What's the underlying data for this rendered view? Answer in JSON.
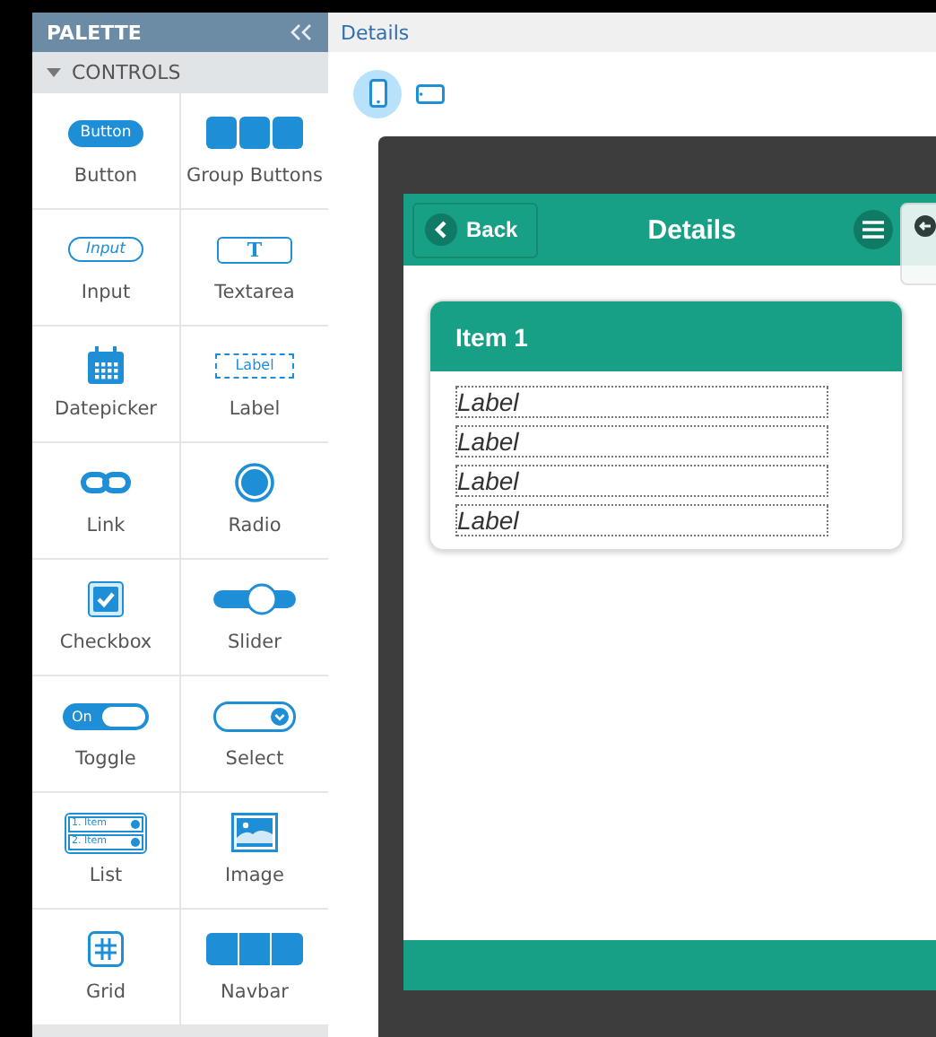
{
  "palette": {
    "title": "PALETTE",
    "section": {
      "label": "CONTROLS",
      "expanded": true
    },
    "items": [
      {
        "kind": "button",
        "label": "Button",
        "icon_text": "Button"
      },
      {
        "kind": "group-buttons",
        "label": "Group Buttons"
      },
      {
        "kind": "input",
        "label": "Input",
        "icon_text": "Input"
      },
      {
        "kind": "textarea",
        "label": "Textarea",
        "icon_text": "T"
      },
      {
        "kind": "datepicker",
        "label": "Datepicker"
      },
      {
        "kind": "label",
        "label": "Label",
        "icon_text": "Label"
      },
      {
        "kind": "link",
        "label": "Link"
      },
      {
        "kind": "radio",
        "label": "Radio"
      },
      {
        "kind": "checkbox",
        "label": "Checkbox"
      },
      {
        "kind": "slider",
        "label": "Slider"
      },
      {
        "kind": "toggle",
        "label": "Toggle",
        "icon_text": "On"
      },
      {
        "kind": "select",
        "label": "Select"
      },
      {
        "kind": "list",
        "label": "List",
        "icon_rows": [
          "1. Item",
          "2. Item"
        ]
      },
      {
        "kind": "image",
        "label": "Image"
      },
      {
        "kind": "grid",
        "label": "Grid"
      },
      {
        "kind": "navbar",
        "label": "Navbar"
      }
    ]
  },
  "editor": {
    "tabs": [
      {
        "label": "Details",
        "selected": true
      }
    ],
    "devices": [
      {
        "kind": "phone",
        "selected": true
      },
      {
        "kind": "tablet",
        "selected": false
      }
    ],
    "screen": {
      "back_button": "Back",
      "title": "Details",
      "card": {
        "title": "Item 1",
        "labels": [
          "Label",
          "Label",
          "Label",
          "Label"
        ]
      }
    }
  }
}
